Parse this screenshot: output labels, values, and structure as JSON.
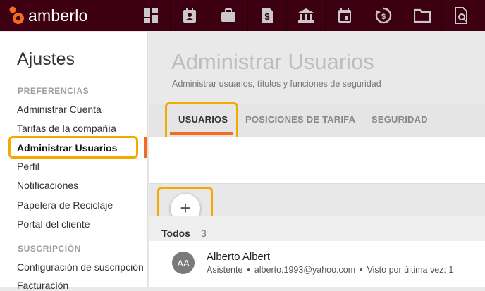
{
  "brand": {
    "name": "amberlo",
    "accent": "#f26b21",
    "topbar_color": "#3d0013"
  },
  "nav": {
    "icons": [
      "dashboard-icon",
      "contacts-icon",
      "briefcase-icon",
      "billing-icon",
      "bank-icon",
      "calendar-icon",
      "time-tracking-icon",
      "folder-icon",
      "documents-icon"
    ]
  },
  "sidebar": {
    "title": "Ajustes",
    "sections": [
      {
        "label": "PREFERENCIAS",
        "items": [
          {
            "label": "Administrar Cuenta",
            "active": false
          },
          {
            "label": "Tarifas de la compañía",
            "active": false
          },
          {
            "label": "Administrar Usuarios",
            "active": true
          },
          {
            "label": "Perfil",
            "active": false
          },
          {
            "label": "Notificaciones",
            "active": false
          },
          {
            "label": "Papelera de Reciclaje",
            "active": false
          },
          {
            "label": "Portal del cliente",
            "active": false
          }
        ]
      },
      {
        "label": "SUSCRIPCIÓN",
        "items": [
          {
            "label": "Configuración de suscripción",
            "active": false
          },
          {
            "label": "Facturación",
            "active": false
          }
        ]
      }
    ]
  },
  "main": {
    "title": "Administrar Usuarios",
    "subtitle": "Administrar usuarios, títulos y funciones de seguridad",
    "tabs": [
      {
        "label": "USUARIOS",
        "active": true
      },
      {
        "label": "POSICIONES DE TARIFA",
        "active": false
      },
      {
        "label": "SEGURIDAD",
        "active": false
      }
    ],
    "add_button": "+",
    "filter": {
      "label": "Todos",
      "count": "3"
    },
    "users": [
      {
        "initials": "AA",
        "name": "Alberto Albert",
        "role": "Asistente",
        "email": "alberto.1993@yahoo.com",
        "last_seen": "Visto por última vez: 1"
      }
    ]
  },
  "highlight_color": "#f2a900"
}
